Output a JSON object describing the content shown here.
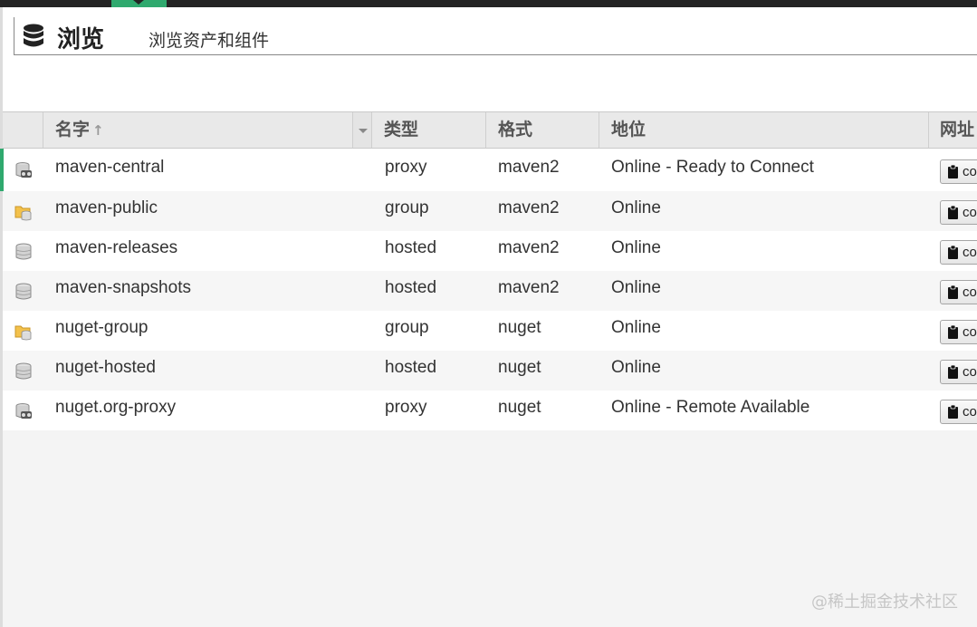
{
  "header": {
    "title": "浏览",
    "subtitle": "浏览资产和组件"
  },
  "grid": {
    "columns": {
      "name": "名字",
      "type": "类型",
      "format": "格式",
      "status": "地位",
      "url": "网址"
    },
    "sort_indicator": "↑",
    "copy_label": "copy",
    "rows": [
      {
        "icon": "proxy-repo-icon",
        "name": "maven-central",
        "type": "proxy",
        "format": "maven2",
        "status": "Online - Ready to Connect"
      },
      {
        "icon": "group-repo-icon",
        "name": "maven-public",
        "type": "group",
        "format": "maven2",
        "status": "Online"
      },
      {
        "icon": "hosted-repo-icon",
        "name": "maven-releases",
        "type": "hosted",
        "format": "maven2",
        "status": "Online"
      },
      {
        "icon": "hosted-repo-icon",
        "name": "maven-snapshots",
        "type": "hosted",
        "format": "maven2",
        "status": "Online"
      },
      {
        "icon": "group-repo-icon",
        "name": "nuget-group",
        "type": "group",
        "format": "nuget",
        "status": "Online"
      },
      {
        "icon": "hosted-repo-icon",
        "name": "nuget-hosted",
        "type": "hosted",
        "format": "nuget",
        "status": "Online"
      },
      {
        "icon": "proxy-repo-icon",
        "name": "nuget.org-proxy",
        "type": "proxy",
        "format": "nuget",
        "status": "Online - Remote Available"
      }
    ]
  },
  "watermark": "@稀土掘金技术社区",
  "colors": {
    "accent": "#2fa96e",
    "topbar": "#242424"
  }
}
